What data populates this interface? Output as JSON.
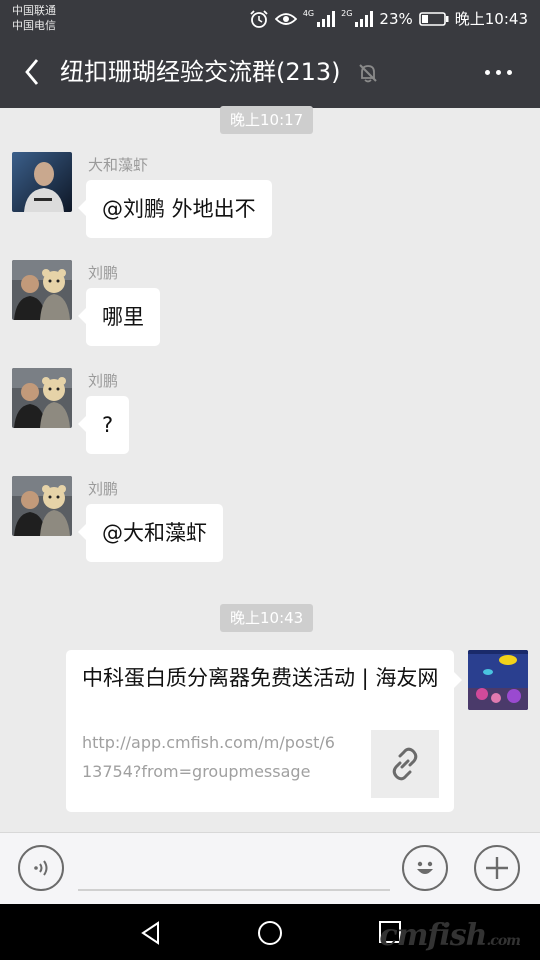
{
  "status_bar": {
    "carrier_1": "中国联通",
    "carrier_2": "中国电信",
    "network_1": "4G",
    "network_2": "2G",
    "battery": "23%",
    "time": "晚上10:43",
    "icons": [
      "alarm-icon",
      "eye-icon",
      "signal-icon",
      "battery-icon"
    ]
  },
  "header": {
    "title": "纽扣珊瑚经验交流群(213)",
    "icons": [
      "back-icon",
      "mute-bell-icon",
      "more-icon"
    ]
  },
  "messages": [
    {
      "type": "time",
      "text": "晚上10:17"
    },
    {
      "type": "text",
      "sender": "大和藻虾",
      "text": "@刘鹏  外地出不"
    },
    {
      "type": "text",
      "sender": "刘鹏",
      "text": "哪里"
    },
    {
      "type": "text",
      "sender": "刘鹏",
      "text": "?"
    },
    {
      "type": "text",
      "sender": "刘鹏",
      "text": "@大和藻虾"
    },
    {
      "type": "time",
      "text": "晚上10:43"
    },
    {
      "type": "link",
      "title": "中科蛋白质分离器免费送活动 | 海友网",
      "url": "http://app.cmfish.com/m/post/613754?from=groupmessage",
      "icon": "link-icon"
    }
  ],
  "input_bar": {
    "icons": [
      "voice-icon",
      "emoji-icon",
      "plus-icon"
    ]
  },
  "nav_bar": {
    "icons": [
      "nav-back-icon",
      "nav-home-icon",
      "nav-recent-icon"
    ],
    "watermark_main": "cmfish",
    "watermark_suffix": ".com"
  },
  "colors": {
    "header_bg": "#393a3f",
    "chat_bg": "#ebebeb",
    "bubble_bg": "#ffffff",
    "time_pill_bg": "#cecece"
  }
}
